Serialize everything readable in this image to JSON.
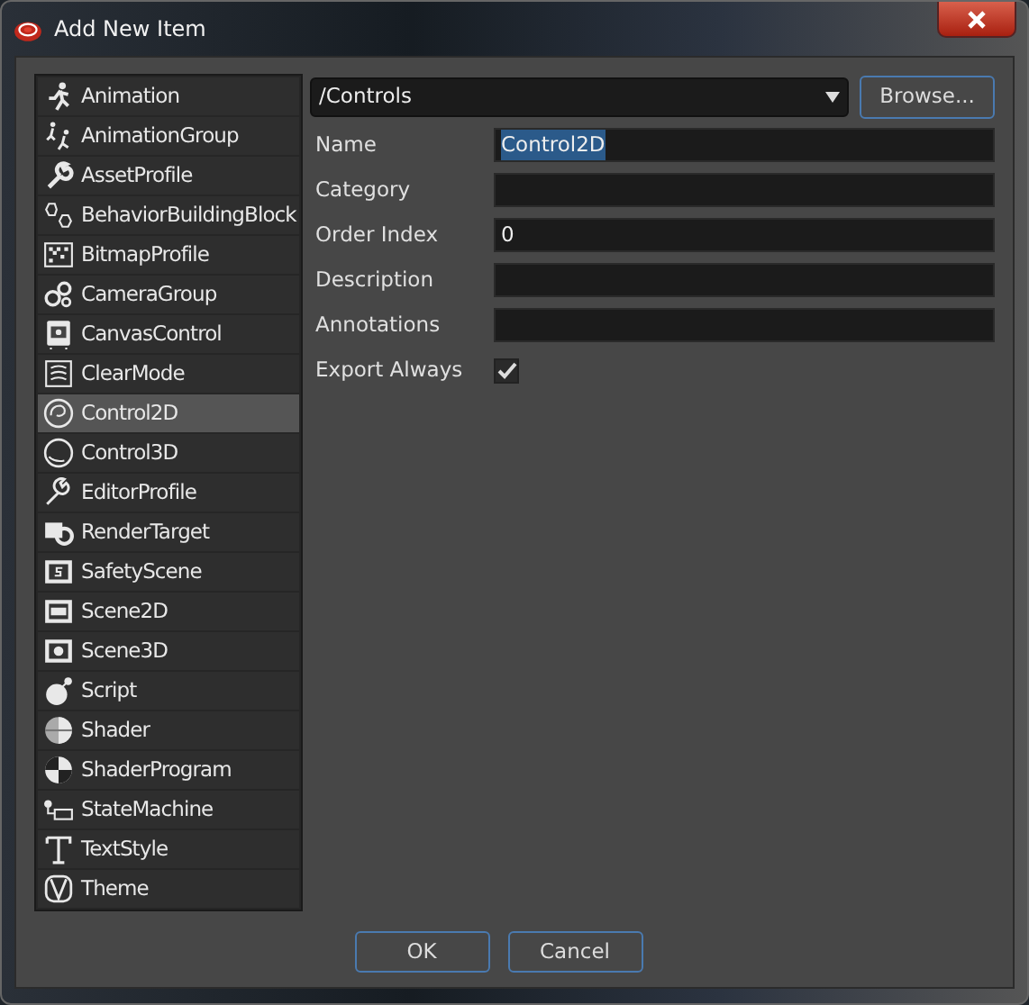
{
  "window": {
    "title": "Add New Item"
  },
  "items": [
    {
      "label": "Animation",
      "selected": false
    },
    {
      "label": "AnimationGroup",
      "selected": false
    },
    {
      "label": "AssetProfile",
      "selected": false
    },
    {
      "label": "BehaviorBuildingBlock",
      "selected": false
    },
    {
      "label": "BitmapProfile",
      "selected": false
    },
    {
      "label": "CameraGroup",
      "selected": false
    },
    {
      "label": "CanvasControl",
      "selected": false
    },
    {
      "label": "ClearMode",
      "selected": false
    },
    {
      "label": "Control2D",
      "selected": true
    },
    {
      "label": "Control3D",
      "selected": false
    },
    {
      "label": "EditorProfile",
      "selected": false
    },
    {
      "label": "RenderTarget",
      "selected": false
    },
    {
      "label": "SafetyScene",
      "selected": false
    },
    {
      "label": "Scene2D",
      "selected": false
    },
    {
      "label": "Scene3D",
      "selected": false
    },
    {
      "label": "Script",
      "selected": false
    },
    {
      "label": "Shader",
      "selected": false
    },
    {
      "label": "ShaderProgram",
      "selected": false
    },
    {
      "label": "StateMachine",
      "selected": false
    },
    {
      "label": "TextStyle",
      "selected": false
    },
    {
      "label": "Theme",
      "selected": false
    }
  ],
  "location": {
    "value": "/Controls",
    "browse_button": "Browse..."
  },
  "fields": [
    {
      "kind": "text",
      "label": "Name",
      "value": "Control2D",
      "text_selected": true
    },
    {
      "kind": "text",
      "label": "Category"
    },
    {
      "kind": "text",
      "label": "Order Index",
      "value": "0"
    },
    {
      "kind": "text",
      "label": "Description"
    },
    {
      "kind": "text",
      "label": "Annotations"
    },
    {
      "kind": "checkbox",
      "label": "Export Always",
      "checked": true
    }
  ],
  "buttons": [
    "OK",
    "Cancel"
  ]
}
